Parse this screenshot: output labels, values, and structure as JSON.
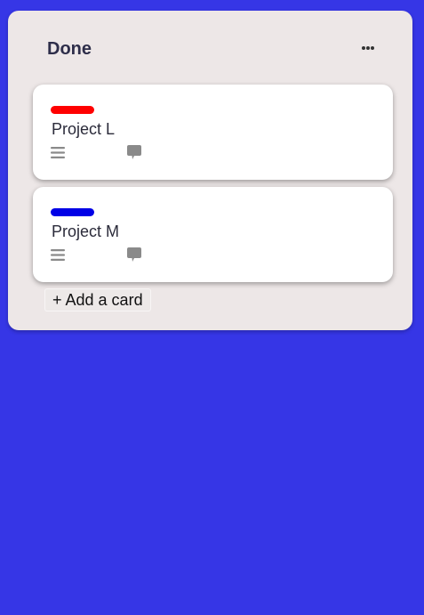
{
  "list": {
    "title": "Done",
    "more_icon": "ellipsis-horizontal-icon",
    "add_card_label": "+ Add a card"
  },
  "cards": [
    {
      "title": "Project L",
      "label_color": "#ff0000",
      "description_icon": "description-lines-icon",
      "comment_icon": "comment-bubble-icon"
    },
    {
      "title": "Project M",
      "label_color": "#0000e6",
      "description_icon": "description-lines-icon",
      "comment_icon": "comment-bubble-icon"
    }
  ],
  "colors": {
    "board_background": "#3636e6",
    "list_background": "#ede7e7",
    "card_background": "#ffffff",
    "icon_gray": "#8a8a8a"
  }
}
